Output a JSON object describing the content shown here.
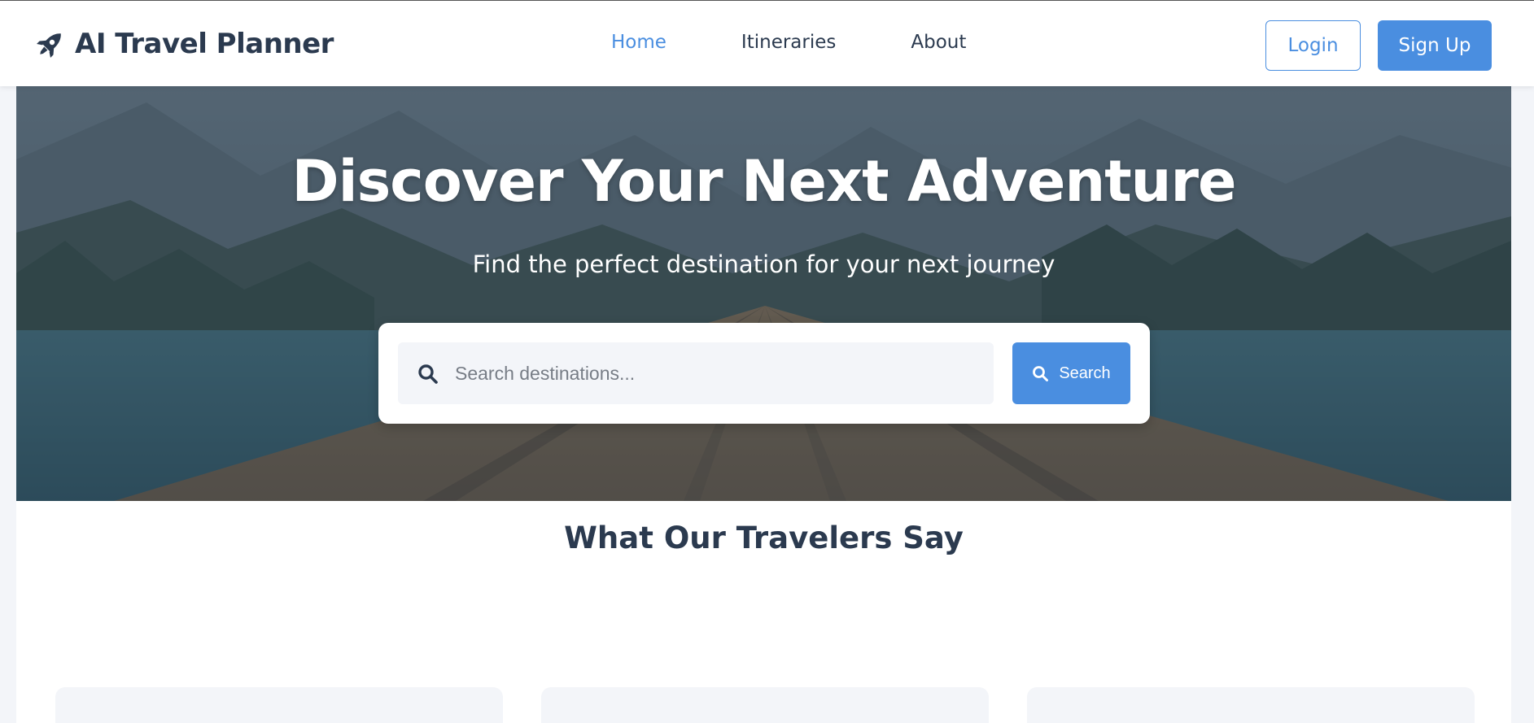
{
  "header": {
    "brand": "AI Travel Planner",
    "brand_icon": "rocket-icon",
    "nav": [
      {
        "label": "Home",
        "active": true
      },
      {
        "label": "Itineraries",
        "active": false
      },
      {
        "label": "About",
        "active": false
      }
    ],
    "login_label": "Login",
    "signup_label": "Sign Up"
  },
  "hero": {
    "title": "Discover Your Next Adventure",
    "subtitle": "Find the perfect destination for your next journey",
    "search": {
      "placeholder": "Search destinations...",
      "value": "",
      "icon": "search-icon",
      "button_label": "Search",
      "button_icon": "search-icon"
    }
  },
  "testimonials": {
    "title": "What Our Travelers Say",
    "card_count": 3
  },
  "colors": {
    "accent": "#4a8ee0",
    "text_dark": "#2b3a4f",
    "header_bg": "#ffffff",
    "page_bg": "#f3f5f9",
    "card_bg": "#f3f5f9"
  }
}
